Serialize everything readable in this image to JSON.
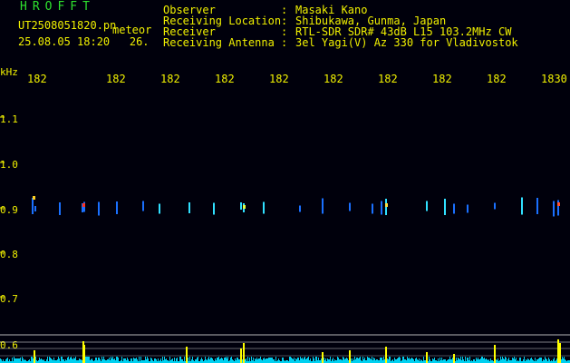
{
  "header": {
    "logo": "HROFFT",
    "filename": "UT2508051820.pn",
    "mode": "meteor",
    "datetime": "25.08.05 18:20",
    "extra": "26.",
    "info": [
      {
        "label": "Observer",
        "value": "Masaki Kano"
      },
      {
        "label": "Receiving Location",
        "value": "Shibukawa, Gunma, Japan"
      },
      {
        "label": "Receiver",
        "value": "RTL-SDR SDR# 43dB L15 103.2MHz CW"
      },
      {
        "label": "Receiving Antenna",
        "value": "3el Yagi(V) Az 330 for Vladivostok"
      }
    ]
  },
  "time_axis": [
    "182",
    "182",
    "182",
    "182",
    "182",
    "182",
    "182",
    "182",
    "182",
    "1830"
  ],
  "freq_axis": {
    "unit": "kHz",
    "ticks": [
      "1.1",
      "1.0",
      "0.9",
      "0.8",
      "0.7",
      "0.6"
    ]
  },
  "colors": {
    "text": "#f0f000",
    "logo": "#2ee02e",
    "power_bar": "#00d8f0",
    "power_peak": "#ffff00"
  }
}
